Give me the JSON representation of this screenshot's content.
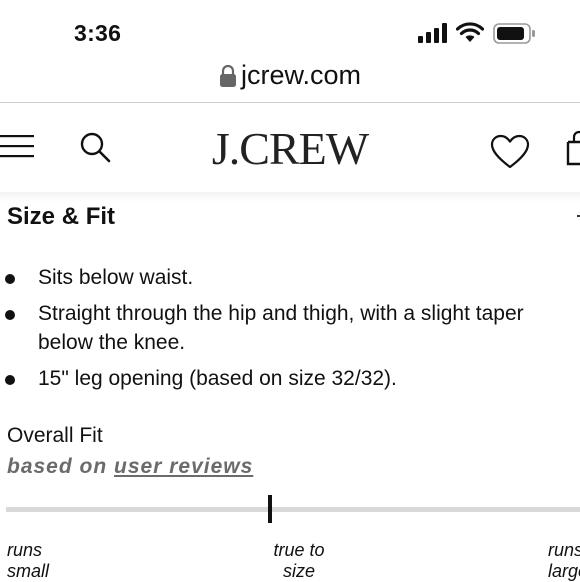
{
  "status_bar": {
    "time": "3:36"
  },
  "browser": {
    "url": "jcrew.com"
  },
  "header": {
    "logo": "J.CREW"
  },
  "size_fit": {
    "title": "Size & Fit",
    "bullets": [
      "Sits below waist.",
      "Straight through the hip and thigh, with a slight taper below the knee.",
      "15\" leg opening (based on size 32/32)."
    ]
  },
  "overall_fit": {
    "heading": "Overall Fit",
    "based_prefix": "based on",
    "reviews_link": "user reviews",
    "level": 0.5,
    "scale_labels": {
      "left_line1": "runs",
      "left_line2": "small",
      "mid_line1": "true to",
      "mid_line2": "size",
      "right_line1": "runs",
      "right_line2": "large"
    }
  }
}
